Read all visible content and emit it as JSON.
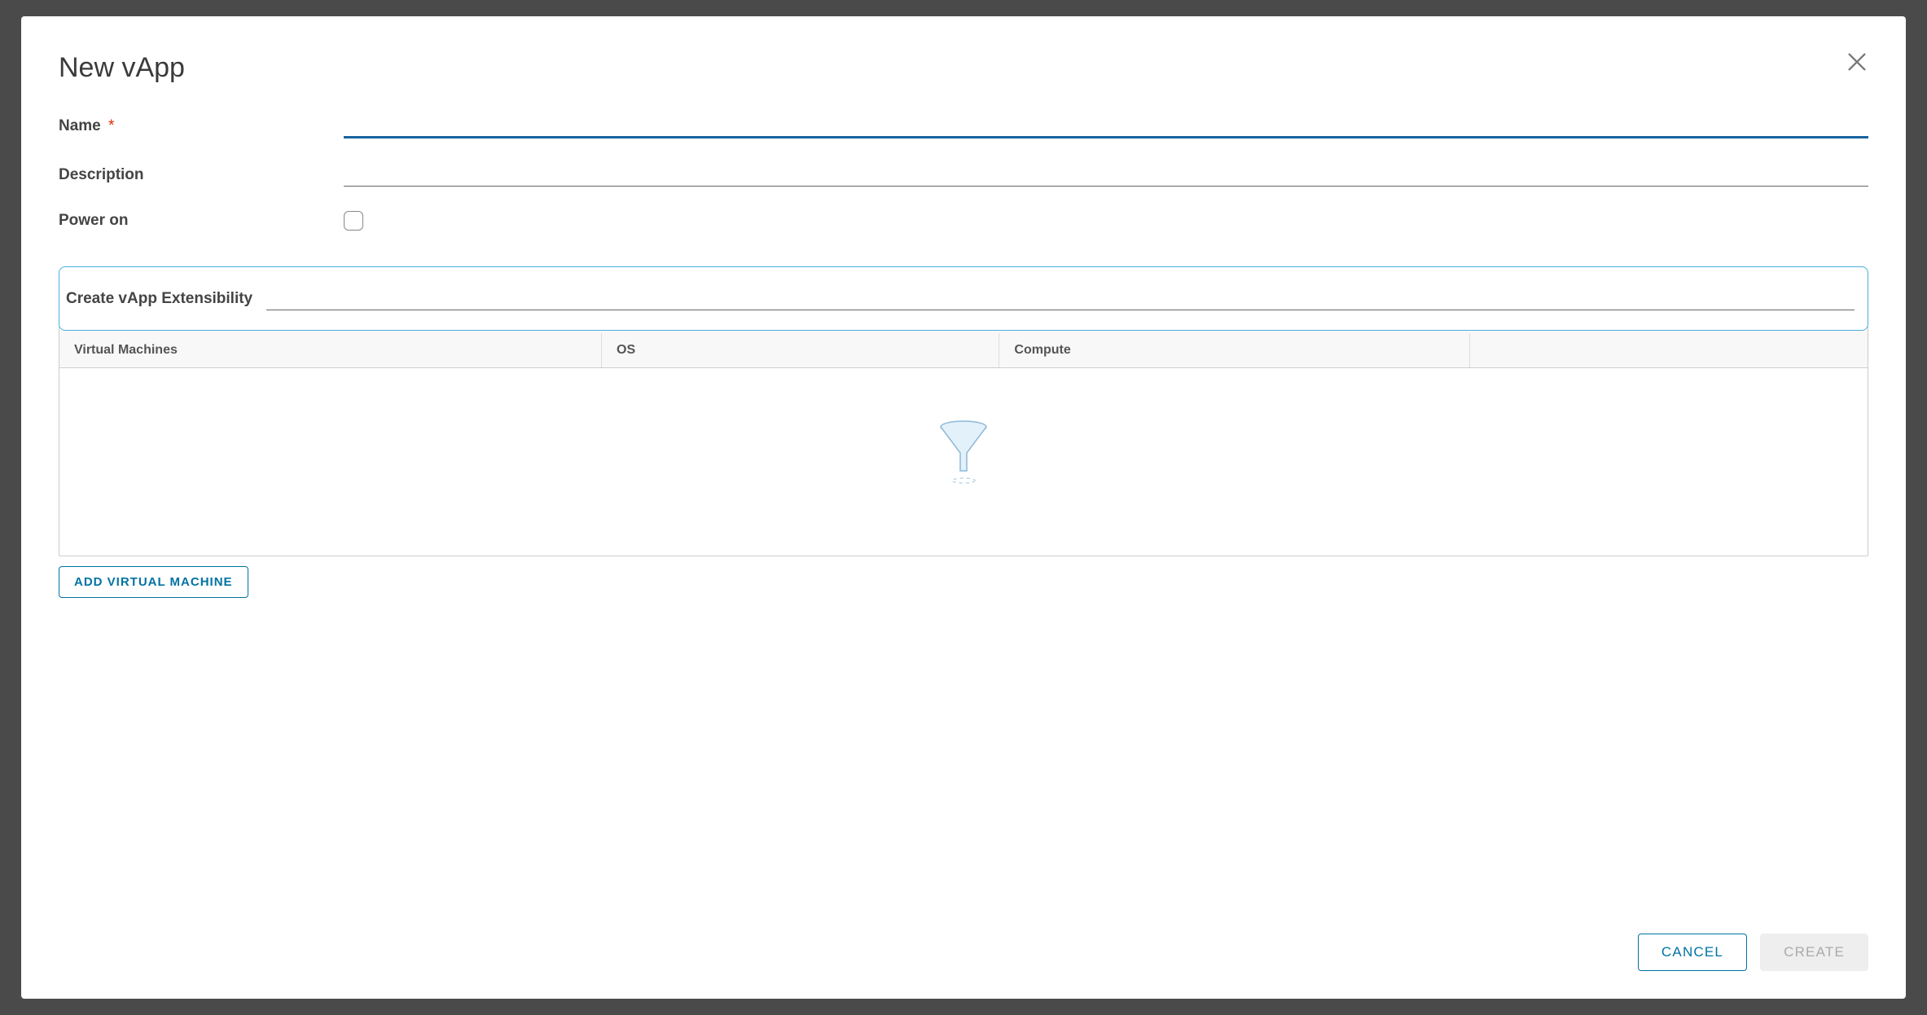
{
  "modal": {
    "title": "New vApp"
  },
  "form": {
    "name": {
      "label": "Name",
      "required": "*",
      "value": ""
    },
    "description": {
      "label": "Description",
      "value": ""
    },
    "powerOn": {
      "label": "Power on",
      "checked": false
    },
    "extensibility": {
      "label": "Create vApp Extensibility",
      "value": ""
    }
  },
  "table": {
    "headers": {
      "vm": "Virtual Machines",
      "os": "OS",
      "compute": "Compute",
      "actions": ""
    },
    "rows": []
  },
  "buttons": {
    "addVm": "ADD VIRTUAL MACHINE",
    "cancel": "CANCEL",
    "create": "CREATE"
  }
}
